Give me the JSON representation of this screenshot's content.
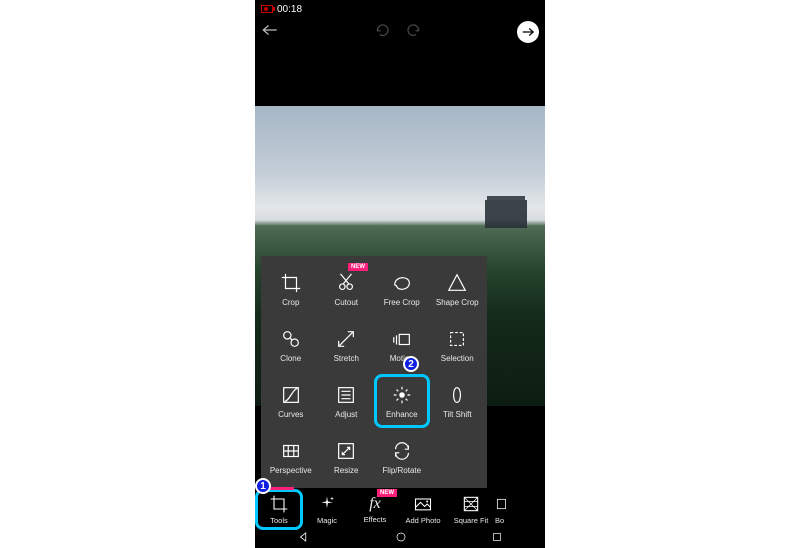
{
  "status": {
    "time": "00:18"
  },
  "annotations": {
    "one": "1",
    "two": "2"
  },
  "badges": {
    "new": "NEW"
  },
  "tools_popup": [
    {
      "id": "crop",
      "label": "Crop",
      "badge": false
    },
    {
      "id": "cutout",
      "label": "Cutout",
      "badge": true
    },
    {
      "id": "freecrop",
      "label": "Free Crop",
      "badge": false
    },
    {
      "id": "shapecrop",
      "label": "Shape Crop",
      "badge": false
    },
    {
      "id": "clone",
      "label": "Clone",
      "badge": false
    },
    {
      "id": "stretch",
      "label": "Stretch",
      "badge": false
    },
    {
      "id": "motion",
      "label": "Motion",
      "badge": false
    },
    {
      "id": "selection",
      "label": "Selection",
      "badge": false
    },
    {
      "id": "curves",
      "label": "Curves",
      "badge": false
    },
    {
      "id": "adjust",
      "label": "Adjust",
      "badge": false
    },
    {
      "id": "enhance",
      "label": "Enhance",
      "badge": false,
      "highlight": true
    },
    {
      "id": "tiltshift",
      "label": "Tilt Shift",
      "badge": false
    },
    {
      "id": "perspective",
      "label": "Perspective",
      "badge": false
    },
    {
      "id": "resize",
      "label": "Resize",
      "badge": false
    },
    {
      "id": "fliprotate",
      "label": "Flip/Rotate",
      "badge": false
    }
  ],
  "bottom_bar": [
    {
      "id": "tools",
      "label": "Tools",
      "highlight": true,
      "badge": false
    },
    {
      "id": "magic",
      "label": "Magic",
      "highlight": false,
      "badge": false
    },
    {
      "id": "effects",
      "label": "Effects",
      "highlight": false,
      "badge": true
    },
    {
      "id": "addphoto",
      "label": "Add Photo",
      "highlight": false,
      "badge": false
    },
    {
      "id": "squarefit",
      "label": "Square Fit",
      "highlight": false,
      "badge": false
    },
    {
      "id": "border",
      "label": "Bo",
      "highlight": false,
      "badge": false
    }
  ]
}
